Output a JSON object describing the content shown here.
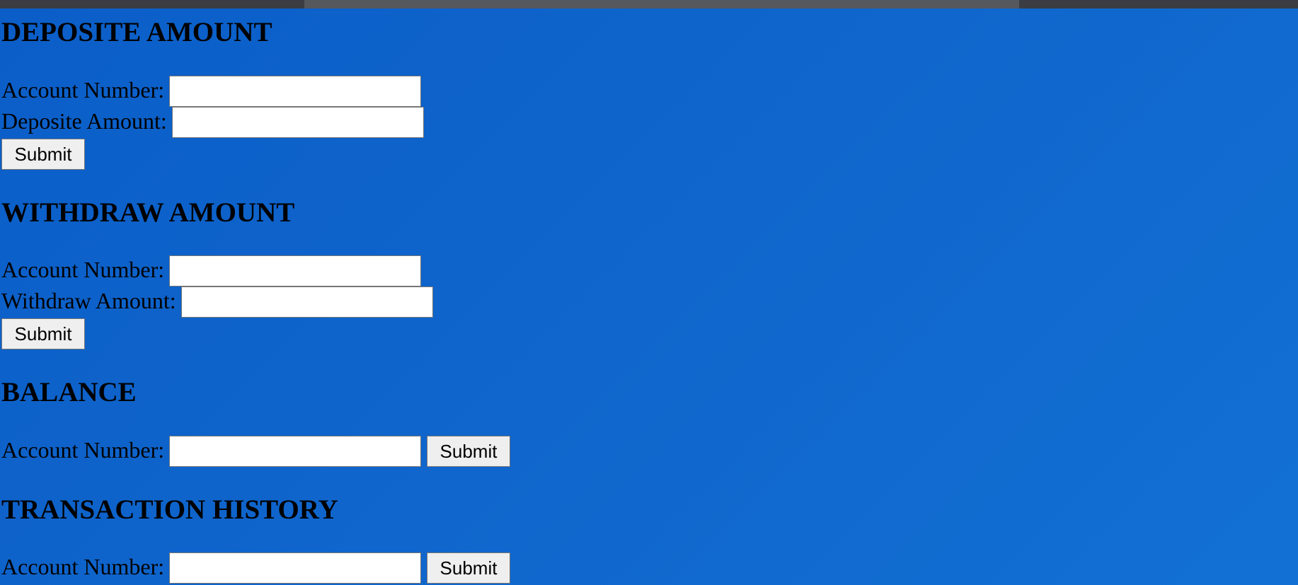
{
  "colors": {
    "background": "#0f66cc",
    "top_strip": "#3a3d42",
    "input_bg": "#ffffff",
    "button_bg": "#efefef"
  },
  "deposit": {
    "heading": "DEPOSITE AMOUNT",
    "account_label": "Account Number:",
    "account_value": "",
    "amount_label": "Deposite Amount:",
    "amount_value": "",
    "submit_label": "Submit"
  },
  "withdraw": {
    "heading": "WITHDRAW AMOUNT",
    "account_label": "Account Number:",
    "account_value": "",
    "amount_label": "Withdraw Amount:",
    "amount_value": "",
    "submit_label": "Submit"
  },
  "balance": {
    "heading": "BALANCE",
    "account_label": "Account Number:",
    "account_value": "",
    "submit_label": "Submit"
  },
  "history": {
    "heading": "TRANSACTION HISTORY",
    "account_label": "Account Number:",
    "account_value": "",
    "submit_label": "Submit"
  }
}
